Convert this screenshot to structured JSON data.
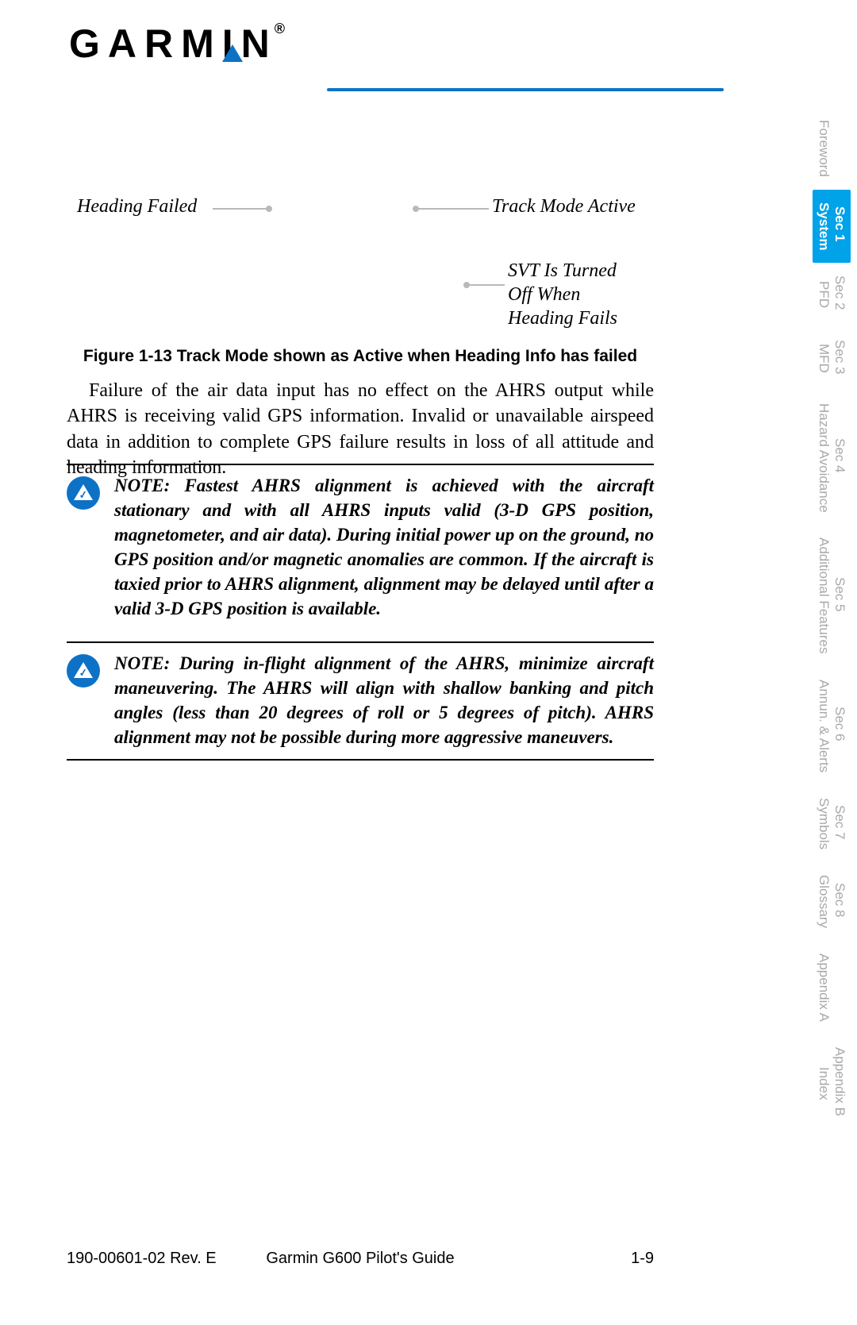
{
  "brand": {
    "name": "GARMIN",
    "reg": "®"
  },
  "annotations": {
    "heading_failed": "Heading Failed",
    "track_mode_active": "Track Mode Active",
    "svt_off": "SVT Is Turned Off When Heading Fails"
  },
  "figure_caption": "Figure 1-13 Track Mode shown as Active when Heading Info has failed",
  "body_paragraph": "Failure of the air data input has no effect on the AHRS output while AHRS is receiving valid GPS information. Invalid or unavailable airspeed data in addition to complete GPS failure results in loss of all attitude and heading information.",
  "notes": [
    {
      "label": "NOTE",
      "text": ":  Fastest AHRS alignment is achieved with the aircraft stationary and with all AHRS inputs valid (3-D GPS position, magnetometer, and air data). During initial power up on the ground, no GPS position and/or magnetic anomalies are common. If the aircraft is taxied prior to AHRS alignment, alignment may be delayed until after a valid 3-D GPS position is available."
    },
    {
      "label": "NOTE",
      "text": ":  During in-flight alignment of the AHRS, minimize aircraft maneuvering. The AHRS will align with shallow banking and pitch angles (less than 20 degrees of roll or 5 degrees of pitch). AHRS alignment may not be possible during more aggressive maneuvers."
    }
  ],
  "tabs": [
    {
      "line1": "Foreword",
      "line2": "",
      "active": false
    },
    {
      "line1": "Sec 1",
      "line2": "System",
      "active": true
    },
    {
      "line1": "Sec 2",
      "line2": "PFD",
      "active": false
    },
    {
      "line1": "Sec 3",
      "line2": "MFD",
      "active": false
    },
    {
      "line1": "Sec 4",
      "line2": "Hazard Avoidance",
      "active": false
    },
    {
      "line1": "Sec 5",
      "line2": "Additional Features",
      "active": false
    },
    {
      "line1": "Sec 6",
      "line2": "Annun. & Alerts",
      "active": false
    },
    {
      "line1": "Sec 7",
      "line2": "Symbols",
      "active": false
    },
    {
      "line1": "Sec 8",
      "line2": "Glossary",
      "active": false
    },
    {
      "line1": "Appendix A",
      "line2": "",
      "active": false
    },
    {
      "line1": "Appendix B",
      "line2": "Index",
      "active": false
    }
  ],
  "footer": {
    "left": "190-00601-02  Rev. E",
    "center": "Garmin G600 Pilot's Guide",
    "right": "1-9"
  }
}
